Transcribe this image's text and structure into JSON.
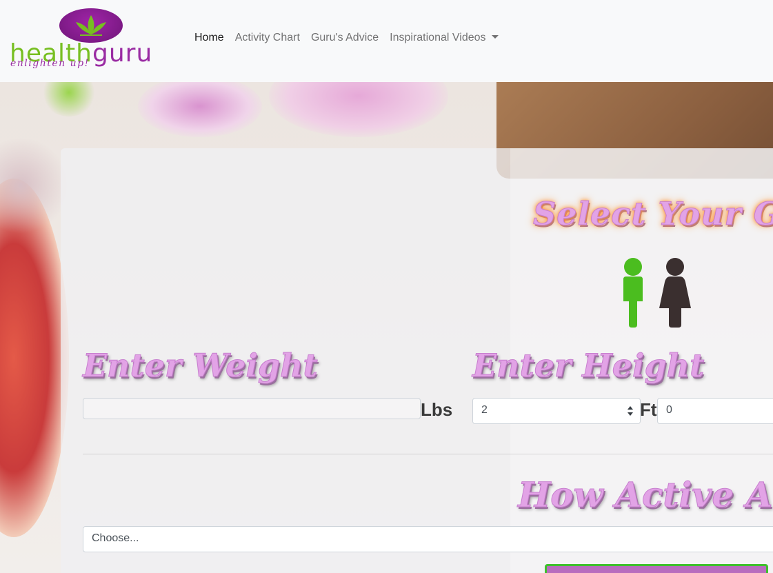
{
  "brand": {
    "name_part1": "health",
    "name_part2": "guru",
    "tagline": "enlighten up!"
  },
  "nav": {
    "items": [
      {
        "label": "Home",
        "active": true
      },
      {
        "label": "Activity Chart",
        "active": false
      },
      {
        "label": "Guru's Advice",
        "active": false
      },
      {
        "label": "Inspirational Videos",
        "active": false,
        "dropdown": true
      }
    ]
  },
  "form": {
    "gender_title": "Select Your Gender",
    "gender_options": [
      {
        "icon": "male-icon",
        "color": "#4bbd1f",
        "selected": true
      },
      {
        "icon": "female-icon",
        "color": "#3a2f2f",
        "selected": false
      }
    ],
    "weight_title": "Enter Weight",
    "weight_value": "",
    "weight_unit": "Lbs",
    "height_title": "Enter Height",
    "height_feet_value": "2",
    "height_feet_unit": "Ft",
    "height_inches_value": "0",
    "activity_title": "How Active Are You",
    "activity_value": "Choose..."
  },
  "colors": {
    "brand_green": "#77bf21",
    "brand_purple": "#9a2ca3",
    "title_pink": "#e2a3e6",
    "button_border": "#3fbf2d"
  }
}
